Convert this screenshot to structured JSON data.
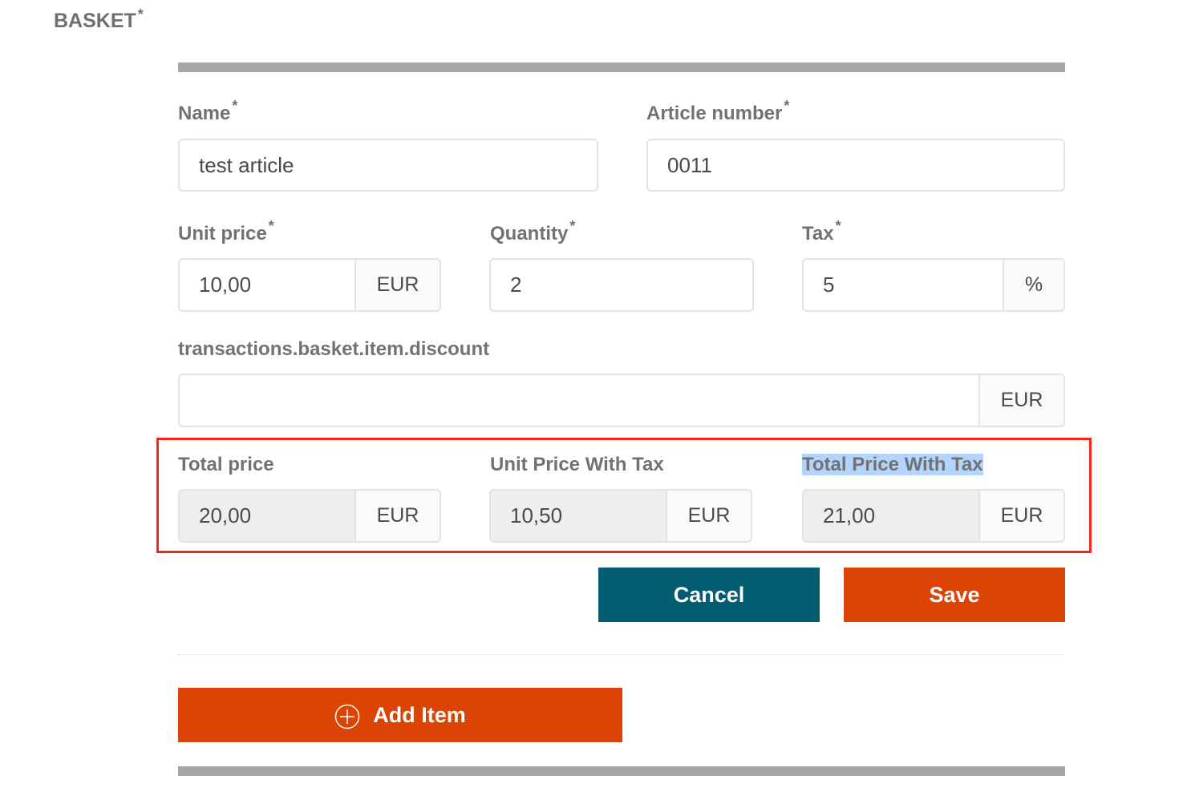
{
  "section": {
    "title": "BASKET",
    "required_marker": "*"
  },
  "form": {
    "name": {
      "label": "Name",
      "required_marker": "*",
      "value": "test article"
    },
    "article_number": {
      "label": "Article number",
      "required_marker": "*",
      "value": "0011"
    },
    "unit_price": {
      "label": "Unit price",
      "required_marker": "*",
      "value": "10,00",
      "currency": "EUR"
    },
    "quantity": {
      "label": "Quantity",
      "required_marker": "*",
      "value": "2"
    },
    "tax": {
      "label": "Tax",
      "required_marker": "*",
      "value": "5",
      "unit": "%"
    },
    "discount": {
      "label": "transactions.basket.item.discount",
      "value": "",
      "currency": "EUR"
    },
    "totals": {
      "total_price": {
        "label": "Total price",
        "value": "20,00",
        "currency": "EUR"
      },
      "unit_price_with_tax": {
        "label": "Unit Price With Tax",
        "value": "10,50",
        "currency": "EUR"
      },
      "total_price_with_tax": {
        "label": "Total Price With Tax",
        "value": "21,00",
        "currency": "EUR"
      }
    }
  },
  "actions": {
    "cancel_label": "Cancel",
    "save_label": "Save",
    "add_item_label": "Add Item"
  },
  "colors": {
    "cancel_bg": "#045c70",
    "primary_bg": "#dc4405",
    "highlight_border": "#f0291a",
    "selection": "#b3d4fd"
  }
}
